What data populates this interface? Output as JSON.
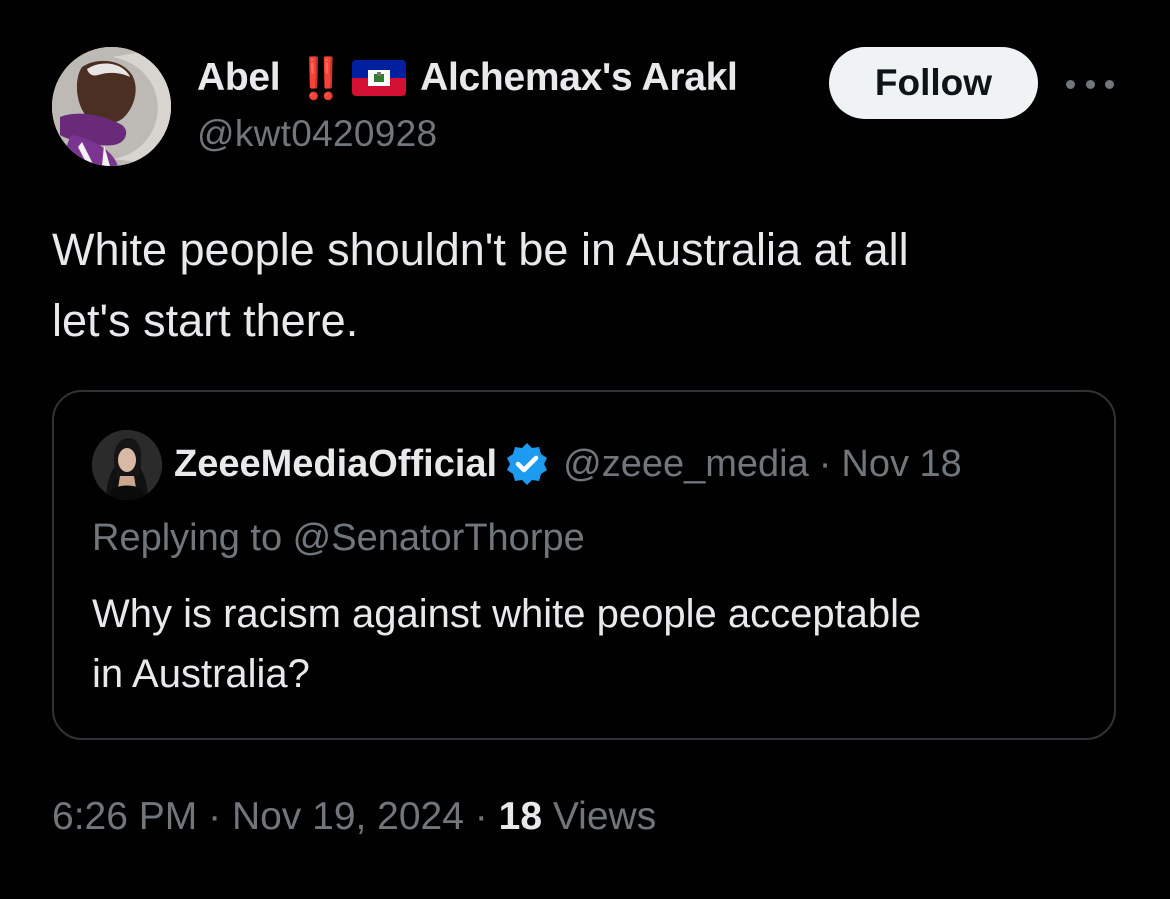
{
  "author": {
    "name": "Abel",
    "emoji_bangbang": "‼️",
    "flag_icon": "haiti-flag-icon",
    "name_suffix": "Alchemax's Arakl",
    "handle": "@kwt0420928",
    "avatar_icon": "user-avatar"
  },
  "actions": {
    "follow_label": "Follow",
    "more_icon": "more-horizontal-icon"
  },
  "tweet": {
    "text": "White people shouldn't be in Australia at all\nlet's start there."
  },
  "quoted_tweet": {
    "name": "ZeeeMediaOfficial",
    "verified_icon": "verified-badge-icon",
    "handle": "@zeee_media",
    "separator": "·",
    "date": "Nov 18",
    "replying_to": "Replying to @SenatorThorpe",
    "text": "Why is racism against white people acceptable\nin Australia?"
  },
  "meta": {
    "time": "6:26 PM",
    "separator": "·",
    "date": "Nov 19, 2024",
    "views_count": "18",
    "views_label": "Views"
  },
  "colors": {
    "background": "#000000",
    "text_primary": "#e7e9ea",
    "text_secondary": "#71767b",
    "border": "#2f3336",
    "follow_bg": "#eff3f4",
    "verified_blue": "#1d9bf0",
    "bangbang_red": "#e0245e"
  }
}
